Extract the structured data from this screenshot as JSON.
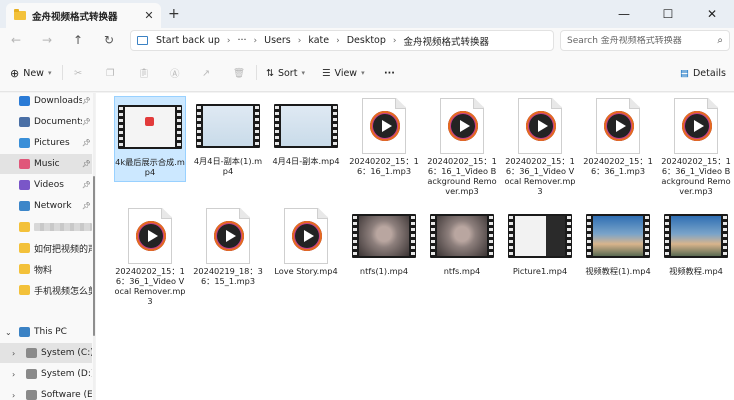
{
  "window": {
    "tab_title": "金舟视频格式转换器",
    "tab_close": "✕",
    "new_tab": "+",
    "minimize": "—",
    "maximize": "☐",
    "close": "✕"
  },
  "address": {
    "start": "Start back up",
    "ellipsis": "···",
    "crumbs": [
      "Users",
      "kate",
      "Desktop",
      "金舟视频格式转换器"
    ],
    "search_placeholder": "Search 金舟视频格式转换器"
  },
  "toolbar": {
    "new_label": "New",
    "sort_label": "Sort",
    "view_label": "View",
    "more_label": "···",
    "details_label": "Details"
  },
  "sidebar": {
    "quick": [
      {
        "label": "Downloads",
        "color": "#2b7bd6"
      },
      {
        "label": "Documents",
        "color": "#4a6fa5"
      },
      {
        "label": "Pictures",
        "color": "#3a8fd8"
      },
      {
        "label": "Music",
        "color": "#e0577a"
      },
      {
        "label": "Videos",
        "color": "#7a56c8"
      },
      {
        "label": "Network",
        "color": "#3c86c9"
      }
    ],
    "folders": [
      "如何把视频的声",
      "物料",
      "手机视频怎么剪"
    ],
    "this_pc": "This PC",
    "drives": [
      "System (C:)",
      "System (D:)",
      "Software (E:)"
    ]
  },
  "files": [
    {
      "name": "4k最后展示合成.mp4",
      "kind": "video",
      "variant": "app",
      "selected": true
    },
    {
      "name": "4月4日-副本(1).mp4",
      "kind": "video",
      "variant": "light"
    },
    {
      "name": "4月4日-副本.mp4",
      "kind": "video",
      "variant": "light"
    },
    {
      "name": "20240202_15：16：16_1.mp3",
      "kind": "audio"
    },
    {
      "name": "20240202_15：16：16_1_Video Background Remover.mp3",
      "kind": "audio"
    },
    {
      "name": "20240202_15：16：36_1_Video Vocal Remover.mp3",
      "kind": "audio"
    },
    {
      "name": "20240202_15：16：36_1.mp3",
      "kind": "audio"
    },
    {
      "name": "20240202_15：16：36_1_Video Background Remover.mp3",
      "kind": "audio"
    },
    {
      "name": "20240202_15：16：36_1_Video Vocal Remover.mp3",
      "kind": "audio"
    },
    {
      "name": "20240219_18：36：15_1.mp3",
      "kind": "audio"
    },
    {
      "name": "Love Story.mp4",
      "kind": "audio"
    },
    {
      "name": "ntfs(1).mp4",
      "kind": "video",
      "variant": "room"
    },
    {
      "name": "ntfs.mp4",
      "kind": "video",
      "variant": "room"
    },
    {
      "name": "Picture1.mp4",
      "kind": "video",
      "variant": "screen"
    },
    {
      "name": "视频教程(1).mp4",
      "kind": "video",
      "variant": "island"
    },
    {
      "name": "视频教程.mp4",
      "kind": "video",
      "variant": "island"
    }
  ],
  "colors": {
    "accent": "#0067c0",
    "selection": "#cce8ff",
    "folder": "#f3c13a"
  }
}
